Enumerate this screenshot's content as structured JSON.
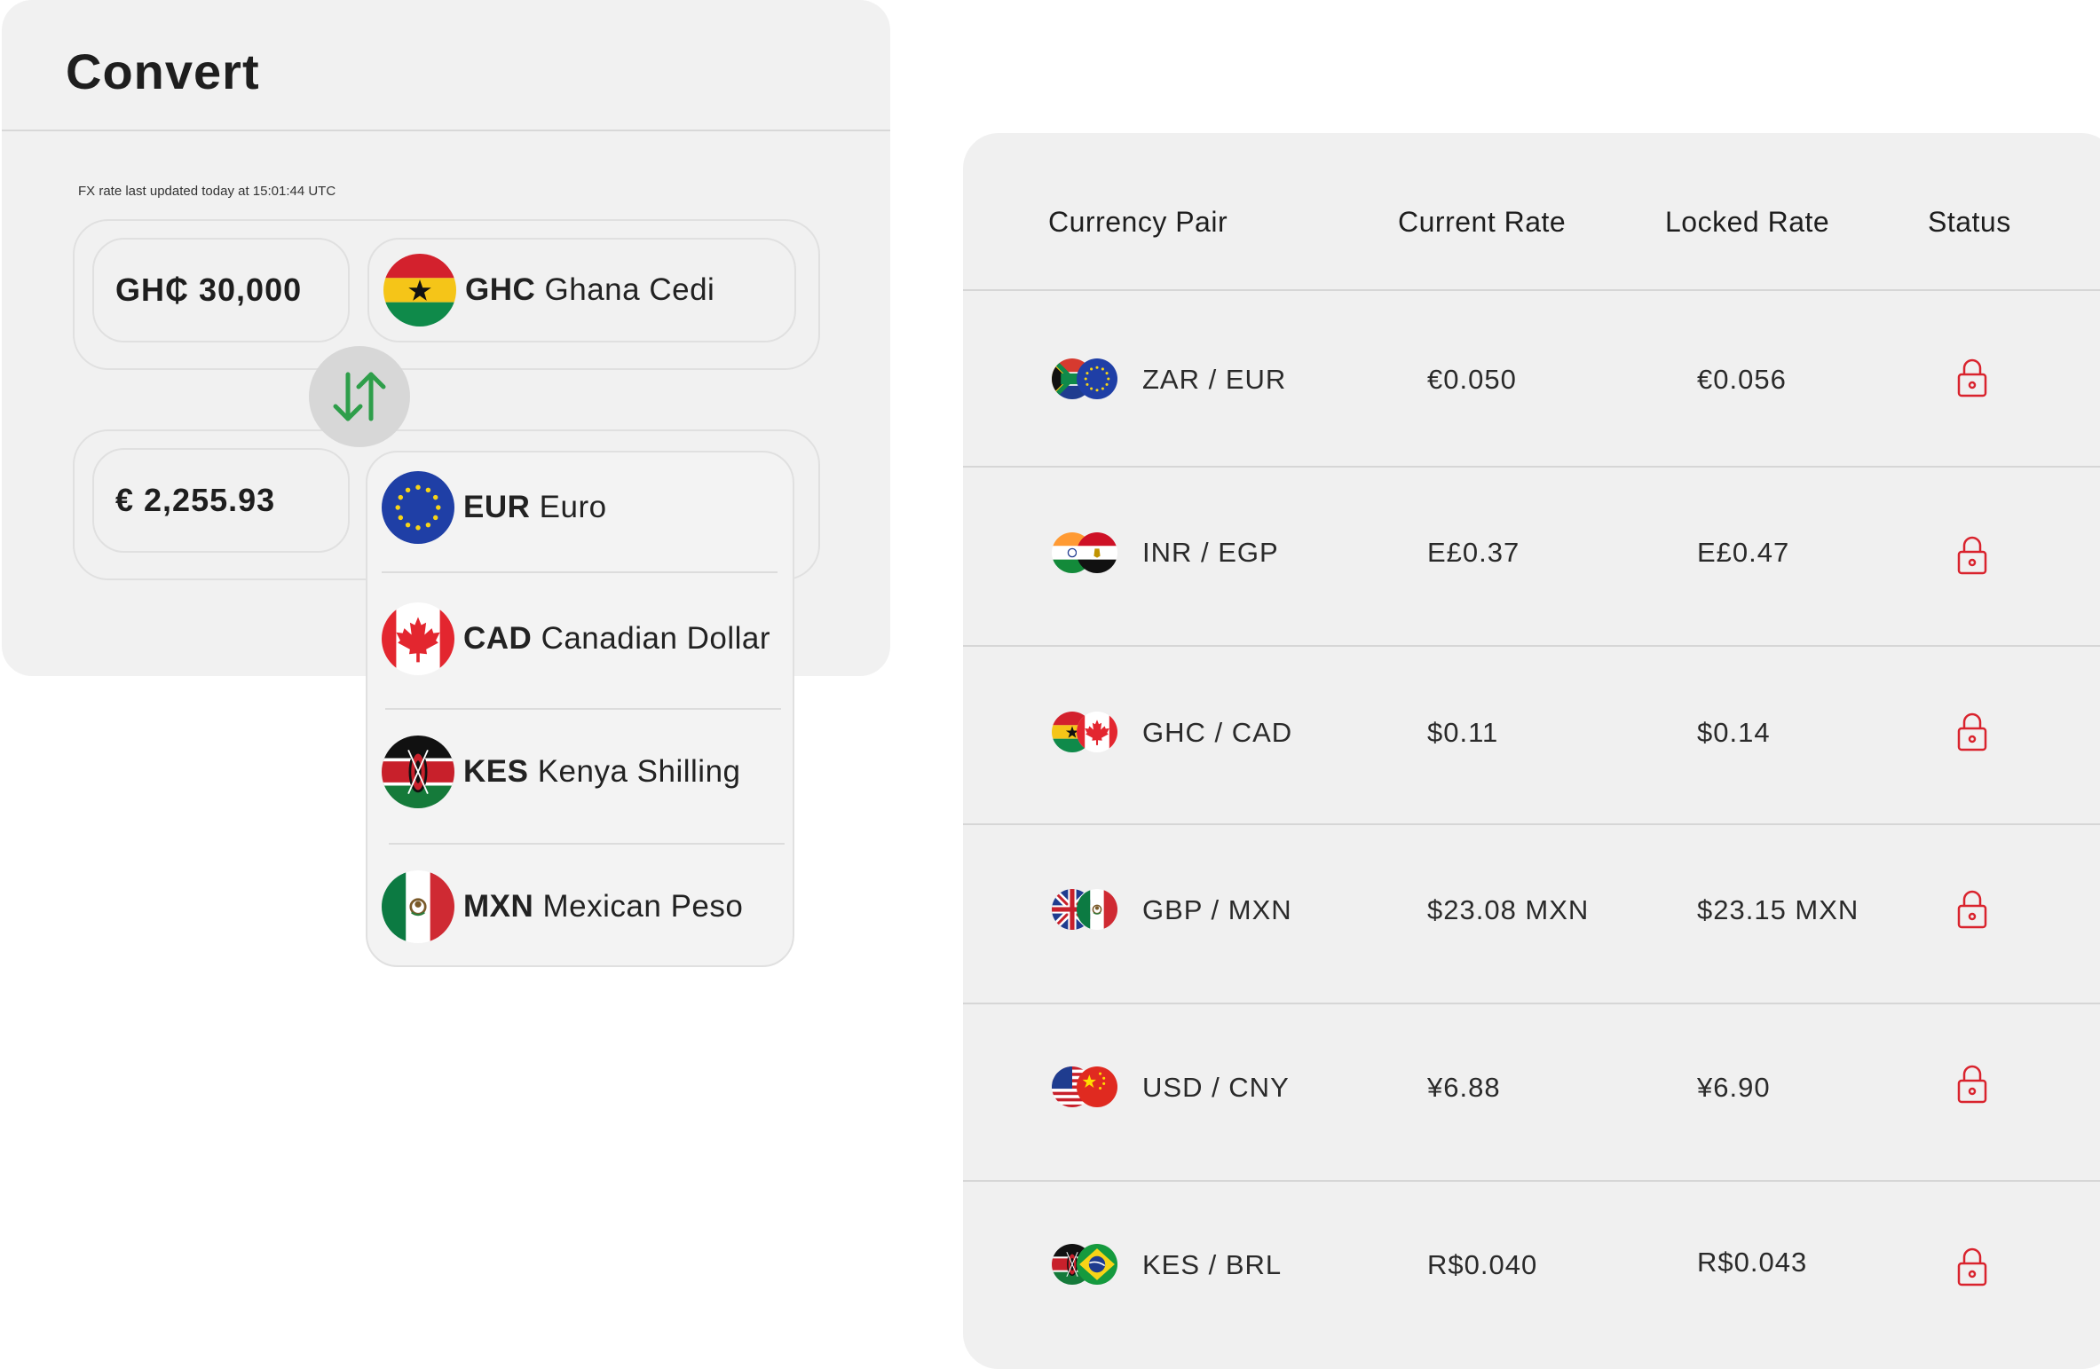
{
  "convert": {
    "title": "Convert",
    "fx_updated": "FX rate last updated today at 15:01:44 UTC",
    "from": {
      "amount": "GH₵ 30,000",
      "code": "GHC",
      "name": "Ghana Cedi",
      "flag_icon": "ghana-flag-icon"
    },
    "to": {
      "amount": "€ 2,255.93",
      "code": "EUR",
      "name": "Euro",
      "flag_icon": "eu-flag-icon"
    },
    "swap_icon": "swap-arrows-icon",
    "swap_color": "#2e9e4a",
    "dropdown_options": [
      {
        "code": "CAD",
        "name": "Canadian Dollar",
        "flag_icon": "canada-flag-icon"
      },
      {
        "code": "KES",
        "name": "Kenya Shilling",
        "flag_icon": "kenya-flag-icon"
      },
      {
        "code": "MXN",
        "name": "Mexican Peso",
        "flag_icon": "mexico-flag-icon"
      }
    ]
  },
  "rates": {
    "headers": {
      "pair": "Currency Pair",
      "current": "Current Rate",
      "locked": "Locked Rate",
      "status": "Status"
    },
    "lock_color": "#d9232d",
    "rows": [
      {
        "pair": "ZAR / EUR",
        "current": "€0.050",
        "locked": "€0.056",
        "status_icon": "lock-icon"
      },
      {
        "pair": "INR / EGP",
        "current": "E£0.37",
        "locked": "E£0.47",
        "status_icon": "lock-icon"
      },
      {
        "pair": "GHC / CAD",
        "current": "$0.11",
        "locked": "$0.14",
        "status_icon": "lock-icon"
      },
      {
        "pair": "GBP / MXN",
        "current": "$23.08 MXN",
        "locked": "$23.15 MXN",
        "status_icon": "lock-icon"
      },
      {
        "pair": "USD / CNY",
        "current": "¥6.88",
        "locked": "¥6.90",
        "status_icon": "lock-icon"
      },
      {
        "pair": "KES / BRL",
        "current": "R$0.040",
        "locked": "R$0.043",
        "status_icon": "lock-icon"
      }
    ]
  }
}
